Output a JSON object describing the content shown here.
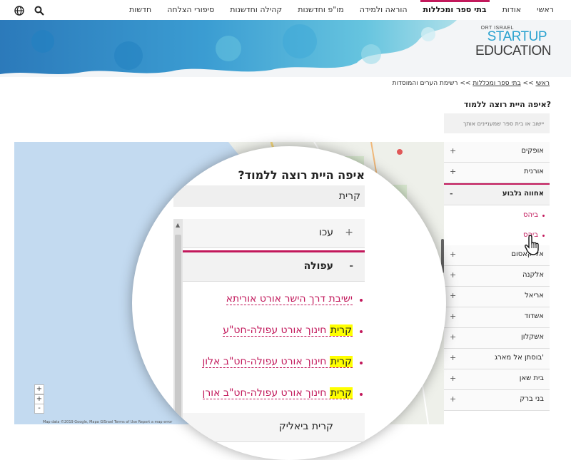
{
  "top_nav": {
    "items": [
      {
        "label": "ראשי",
        "active": false
      },
      {
        "label": "אודות",
        "active": false
      },
      {
        "label": "בתי ספר ומכללות",
        "active": true
      },
      {
        "label": "הוראה ולמידה",
        "active": false
      },
      {
        "label": "מו\"פ וחדשנות",
        "active": false
      },
      {
        "label": "קהילה וחדשנות",
        "active": false
      },
      {
        "label": "סיפורי הצלחה",
        "active": false
      },
      {
        "label": "חדשות",
        "active": false
      }
    ],
    "icons": [
      "globe-icon",
      "search-icon"
    ]
  },
  "logo": {
    "small": "ORT ISRAEL",
    "line1": "STARTUP",
    "line2": "EDUCATION"
  },
  "breadcrumb": {
    "home": "ראשי",
    "section": "בתי ספר ומכללות",
    "current": "רשימת הערים והמוסדות",
    "separator": ">>"
  },
  "sidebar": {
    "question": "איפה היית רוצה ללמוד?",
    "search_placeholder": "יישוב או בית ספר שמעניינים אותך",
    "cities": [
      {
        "label": "אופקים",
        "toggle": "+"
      },
      {
        "label": "אורנית",
        "toggle": "+"
      },
      {
        "label": "אחווה גלבוע",
        "toggle": "-",
        "open": true,
        "schools": [
          "ביהס",
          "ביהס"
        ]
      },
      {
        "label": "אל-קאסום",
        "toggle": "+"
      },
      {
        "label": "אלקנה",
        "toggle": "+"
      },
      {
        "label": "אריאל",
        "toggle": "+"
      },
      {
        "label": "אשדוד",
        "toggle": "+"
      },
      {
        "label": "אשקלון",
        "toggle": "+"
      },
      {
        "label": "בוסתן אל מארג'",
        "toggle": "+"
      },
      {
        "label": "בית שאן",
        "toggle": "+"
      },
      {
        "label": "בני ברק",
        "toggle": "+"
      }
    ]
  },
  "magnifier": {
    "question": "איפה היית רוצה ללמוד?",
    "search_value": "קרית",
    "rows": [
      {
        "label": "עכו",
        "toggle": "+"
      },
      {
        "label": "עפולה",
        "toggle": "-"
      }
    ],
    "links": [
      {
        "before": "",
        "highlight": "",
        "after": "ישיבת דרך הישר אורט אוריתא"
      },
      {
        "before": "",
        "highlight": "קרית",
        "after": " חינוך אורט עפולה-חט\"ע"
      },
      {
        "before": "",
        "highlight": "קרית",
        "after": " חינוך אורט עפולה-חט\"ב אלון"
      },
      {
        "before": "",
        "highlight": "קרית",
        "after": " חינוך אורט עפולה-חט\"ב אורן"
      }
    ],
    "next_row": "קרית ביאליק"
  },
  "map": {
    "zoom_in": "+",
    "zoom_out": "-",
    "footer": "Map data ©2019 Google, Mapa GISrael  Terms of Use  Report a map error"
  },
  "colors": {
    "accent": "#c2185b",
    "highlight": "#ffff00",
    "map_water": "#c3daf0",
    "banner_blue": "#2a8fc9"
  }
}
